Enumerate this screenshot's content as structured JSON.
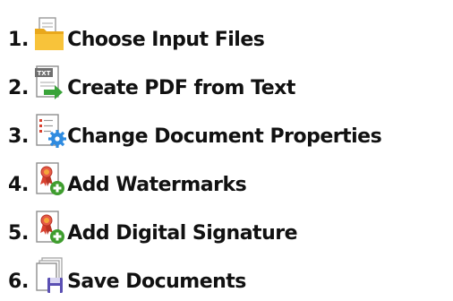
{
  "wizard": {
    "steps": [
      {
        "number": "1.",
        "label": "Choose Input Files",
        "icon": "folder-icon"
      },
      {
        "number": "2.",
        "label": "Create PDF from Text",
        "icon": "txt-to-pdf-icon"
      },
      {
        "number": "3.",
        "label": "Change Document Properties",
        "icon": "document-properties-icon"
      },
      {
        "number": "4.",
        "label": "Add Watermarks",
        "icon": "add-watermark-icon"
      },
      {
        "number": "5.",
        "label": "Add Digital Signature",
        "icon": "add-signature-icon"
      },
      {
        "number": "6.",
        "label": "Save Documents",
        "icon": "save-documents-icon"
      }
    ],
    "icon_labels": {
      "txt_badge": "TXT"
    },
    "colors": {
      "text": "#111111",
      "folder": "#f6b82a",
      "arrow_green": "#3aa33a",
      "gear_blue": "#2e8be0",
      "plus_green": "#3f9d2f",
      "save_purple": "#5a4fb3",
      "ribbon_red": "#d9412f"
    }
  }
}
